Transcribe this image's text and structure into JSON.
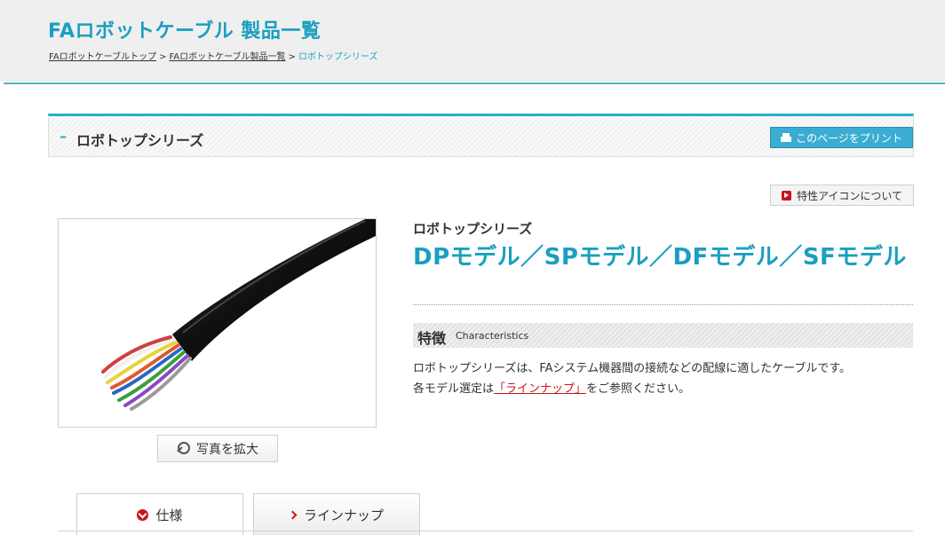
{
  "header": {
    "site_title": "FAロボットケーブル  製品一覧",
    "breadcrumb": {
      "item1": "FAロボットケーブルトップ",
      "item2": "FAロボットケーブル製品一覧",
      "current": "ロボトップシリーズ",
      "separator": ">"
    }
  },
  "section": {
    "title": "ロボトップシリーズ",
    "print_button": "このページをプリント",
    "print_icon": "printer-icon"
  },
  "feature_icon_button": "特性アイコンについて",
  "product": {
    "series": "ロボトップシリーズ",
    "title_parts": [
      "DP",
      "モデル／",
      "SP",
      "モデル／",
      "DF",
      "モデル／",
      "SF",
      "モデル"
    ],
    "zoom_button": "写真を拡大",
    "photo_alt": "cable-photo"
  },
  "characteristics": {
    "heading_jp": "特徴",
    "heading_en": "Characteristics",
    "line1": "ロボトップシリーズは、FAシステム機器間の接続などの配線に適したケーブルです。",
    "line2_before": "各モデル選定は",
    "line2_link": "「ラインナップ」",
    "line2_after": "をご参照ください。"
  },
  "tabs": [
    {
      "label": "仕様",
      "active": true
    },
    {
      "label": "ラインナップ",
      "active": false
    }
  ],
  "colors": {
    "accent": "#1a9fc0",
    "brand_red": "#c8161d",
    "print_button_bg": "#3cadd2"
  }
}
